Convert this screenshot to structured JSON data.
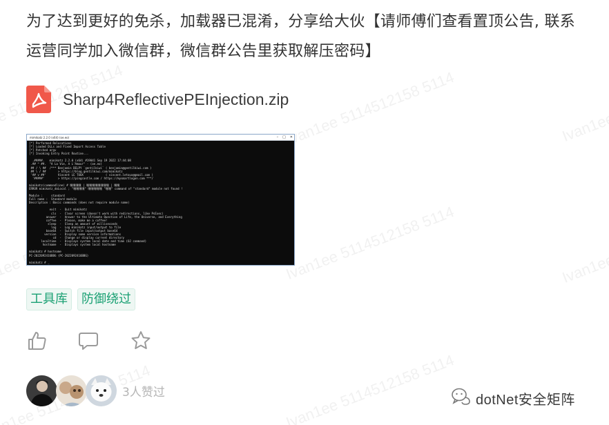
{
  "post": {
    "line1": "为了达到更好的免杀，加载器已混淆，分享给大伙【请师傅们查看置顶公告, 联系",
    "line2": "运营同学加入微信群，微信群公告里获取解压密码】"
  },
  "attachment": {
    "file_name": "Sharp4ReflectivePEInjection.zip",
    "icon": "pdf-file-icon",
    "icon_color": "#f0584a"
  },
  "screenshot": {
    "window_title": "mimikatz 2.2.0 (x64) (oe.eo)",
    "console_lines": [
      "[*] Performed Relocations",
      "[*] Loaded DLLs and Fixed Import Access Table",
      "[*] Patched argv",
      "[*] Invoking Entry Point Routine...",
      "",
      "  .#####.   mimikatz 2.2.0 (x64) #19041 Sep 19 2022 17:44:08",
      " .## ^ ##.  \"A La Vie, A L'Amour\" - (oe.eo)",
      " ## / \\ ##  /*** Benjamin DELPY `gentilkiwi` ( benjamin@gentilkiwi.com )",
      " ## \\ / ##       > https://blog.gentilkiwi.com/mimikatz",
      " '## v ##'       Vincent LE TOUX             ( vincent.letoux@gmail.com )",
      "  '#####'        > https://pingcastle.com / https://mysmartlogon.com ***/",
      "",
      "mimikatz(commandline) # 嘿嘿嘿嘿 | 嘿嘿嘿嘿嘿嘿嘿嘿 | 嘿嘿",
      "ERROR mimikatz_doLocal ; \"嘿嘿嘿嘿\" 嘿嘿嘿嘿嘿 \"嘿嘿\" command of \"standard\" module not found !",
      "",
      "Module :     standard",
      "Full name :  Standard module",
      "Description : Basic commands (does not require module name)",
      "",
      "            exit  -  Quit mimikatz",
      "             cls  -  Clear screen (doesn't work with redirections, like PsExec)",
      "          answer  -  Answer to the Ultimate Question of Life, the Universe, and Everything",
      "          coffee  -  Please, make me a coffee!",
      "           sleep  -  Sleep an amount of milliseconds",
      "             log  -  Log mimikatz input/output to file",
      "          base64  -  Switch file input/output base64",
      "         version  -  Display some version informations",
      "              cd  -  Change or display current directory",
      "       localtime  -  Displays system local date and time (OJ command)",
      "        hostname  -  Displays system local hostname",
      "",
      "mimikatz # hostname",
      "PC-2022092416BBG (PC-2022092416BBG)",
      "",
      "mimikatz # _"
    ]
  },
  "tags": [
    "工具库",
    "防御绕过"
  ],
  "actions": {
    "like_icon": "thumbs-up-icon",
    "comment_icon": "comment-icon",
    "favorite_icon": "star-icon"
  },
  "likers": {
    "text": "3人赞过"
  },
  "brand": {
    "name": "dotNet安全矩阵",
    "icon": "wechat-official-account-icon"
  },
  "watermark": {
    "text": "Ivan1ee 5114512158 5114"
  }
}
